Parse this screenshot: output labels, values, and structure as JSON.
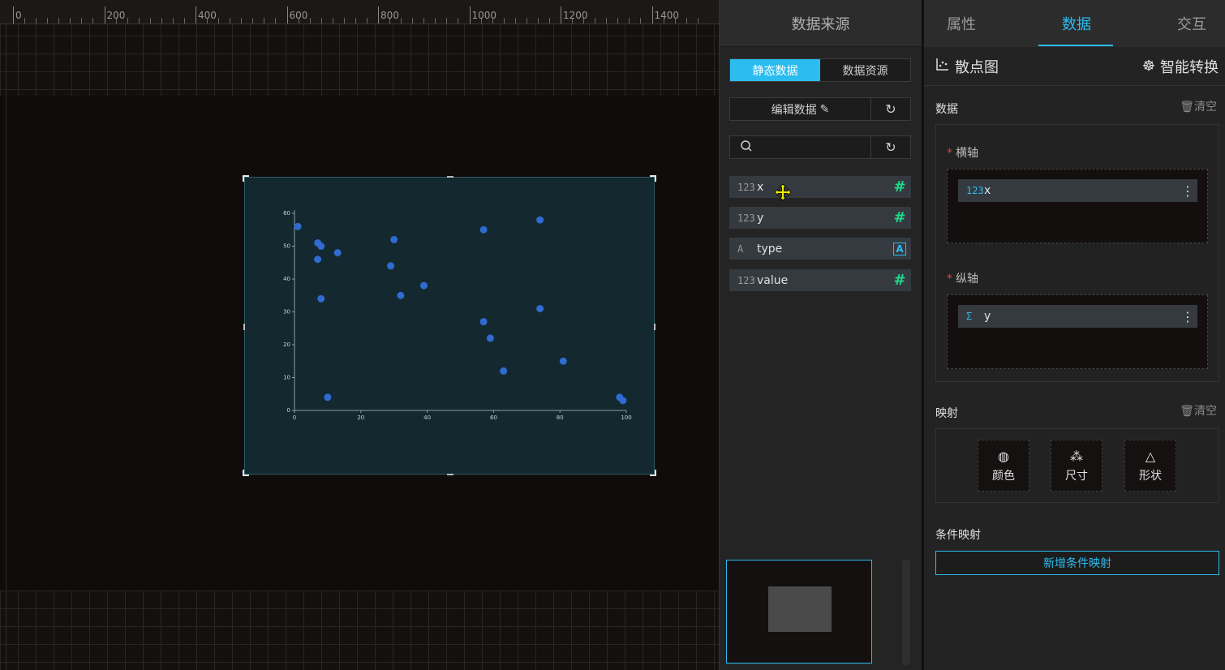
{
  "ruler": {
    "labels": [
      "0",
      "200",
      "400",
      "600",
      "800",
      "1000",
      "1200",
      "1400"
    ]
  },
  "mid": {
    "header": "数据来源",
    "seg_static": "静态数据",
    "seg_resource": "数据资源",
    "edit_label": "编辑数据",
    "search_placeholder": "",
    "fields": [
      {
        "icon": "123",
        "name": "x",
        "type_icon": "#"
      },
      {
        "icon": "123",
        "name": "y",
        "type_icon": "#"
      },
      {
        "icon": "A",
        "name": "type",
        "type_icon": "A"
      },
      {
        "icon": "123",
        "name": "value",
        "type_icon": "#"
      }
    ]
  },
  "right": {
    "tabs": [
      "属性",
      "数据",
      "交互"
    ],
    "chart_type": "散点图",
    "smart_convert": "智能转换",
    "data_title": "数据",
    "clear_label": "清空",
    "x_axis_label": "横轴",
    "y_axis_label": "纵轴",
    "x_chip": {
      "icon": "123",
      "name": "x"
    },
    "y_chip": {
      "icon": "Σ",
      "name": "y"
    },
    "mapping_title": "映射",
    "map_color": "颜色",
    "map_size": "尺寸",
    "map_shape": "形状",
    "cond_title": "条件映射",
    "add_cond": "新增条件映射"
  },
  "colors": {
    "accent": "#2bbcf0",
    "point": "#2f6bd0",
    "green": "#20d889"
  },
  "chart_data": {
    "type": "scatter",
    "xlim": [
      0,
      100
    ],
    "ylim": [
      0,
      60
    ],
    "xticks": [
      0,
      20,
      40,
      60,
      80,
      100
    ],
    "yticks": [
      0,
      10,
      20,
      30,
      40,
      50,
      60
    ],
    "points": [
      [
        1,
        56
      ],
      [
        7,
        51
      ],
      [
        8,
        50
      ],
      [
        7,
        46
      ],
      [
        13,
        48
      ],
      [
        8,
        34
      ],
      [
        10,
        4
      ],
      [
        30,
        52
      ],
      [
        29,
        44
      ],
      [
        32,
        35
      ],
      [
        39,
        38
      ],
      [
        57,
        55
      ],
      [
        57,
        27
      ],
      [
        59,
        22
      ],
      [
        63,
        12
      ],
      [
        74,
        58
      ],
      [
        74,
        31
      ],
      [
        81,
        15
      ],
      [
        98,
        4
      ],
      [
        99,
        3
      ]
    ]
  }
}
